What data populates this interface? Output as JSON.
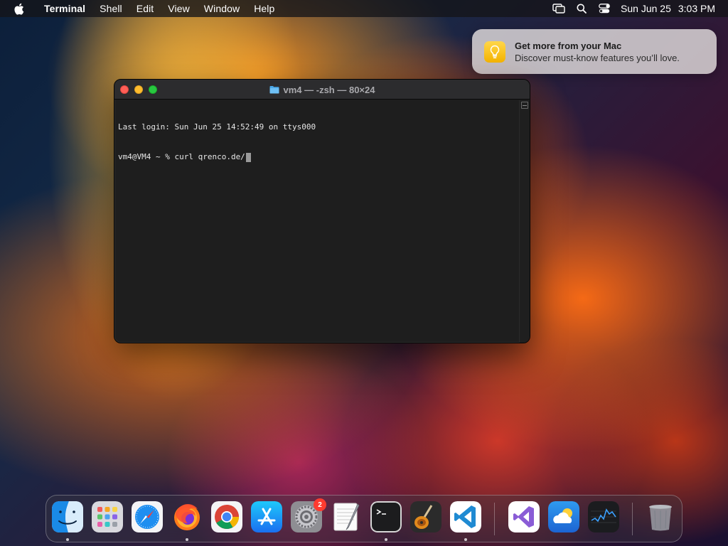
{
  "menubar": {
    "app_name": "Terminal",
    "items": [
      "Shell",
      "Edit",
      "View",
      "Window",
      "Help"
    ],
    "date": "Sun Jun 25",
    "time": "3:03 PM"
  },
  "notification": {
    "title": "Get more from your Mac",
    "body": "Discover must-know features you’ll love.",
    "icon": "lightbulb-icon"
  },
  "terminal": {
    "title": "vm4 — -zsh — 80×24",
    "lines": [
      "Last login: Sun Jun 25 14:52:49 on ttys000",
      "vm4@VM4 ~ % curl qrenco.de/"
    ]
  },
  "dock": {
    "apps": [
      {
        "name": "Finder",
        "icon": "finder-icon",
        "running": true
      },
      {
        "name": "Launchpad",
        "icon": "launchpad-icon",
        "running": false
      },
      {
        "name": "Safari",
        "icon": "safari-icon",
        "running": false
      },
      {
        "name": "Firefox",
        "icon": "firefox-icon",
        "running": true
      },
      {
        "name": "Google Chrome",
        "icon": "chrome-icon",
        "running": false
      },
      {
        "name": "App Store",
        "icon": "app-store-icon",
        "running": false
      },
      {
        "name": "System Settings",
        "icon": "system-settings-icon",
        "running": false,
        "badge": "2"
      },
      {
        "name": "TextEdit",
        "icon": "textedit-icon",
        "running": false
      },
      {
        "name": "Terminal",
        "icon": "terminal-icon",
        "running": true
      },
      {
        "name": "GarageBand",
        "icon": "garageband-icon",
        "running": false
      },
      {
        "name": "Visual Studio Code",
        "icon": "vscode-icon",
        "running": true
      },
      {
        "name": "Visual Studio",
        "icon": "visual-studio-icon",
        "running": false
      },
      {
        "name": "Weather",
        "icon": "weather-icon",
        "running": false
      },
      {
        "name": "Stocks",
        "icon": "stocks-icon",
        "running": false
      },
      {
        "name": "Trash",
        "icon": "trash-icon",
        "running": false
      }
    ],
    "colors": {
      "accent_red": "#ff3b30"
    }
  }
}
